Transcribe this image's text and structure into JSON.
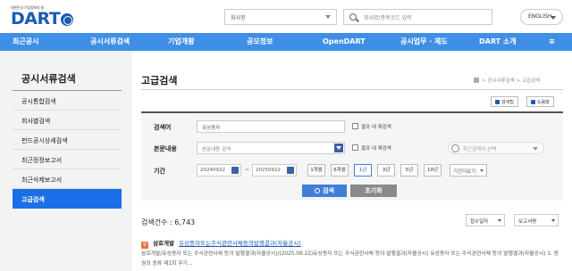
{
  "header": {
    "logo_small": "대한민국 기업정보의 창",
    "logo_big": "DART",
    "company_select": "회사명",
    "search_placeholder": "회사명/종목코드 입력",
    "language": "ENGLISH"
  },
  "nav": [
    {
      "label": "최근공시"
    },
    {
      "label": "공시서류검색"
    },
    {
      "label": "기업개황"
    },
    {
      "label": "공모정보"
    },
    {
      "label": "OpenDART"
    },
    {
      "label": "공시업무 · 제도"
    },
    {
      "label": "DART 소개"
    }
  ],
  "sidebar": {
    "title": "공시서류검색",
    "items": [
      {
        "label": "공시통합검색",
        "active": false
      },
      {
        "label": "회사별검색",
        "active": false
      },
      {
        "label": "펀드공시상세검색",
        "active": false
      },
      {
        "label": "최근정정보고서",
        "active": false
      },
      {
        "label": "최근삭제보고서",
        "active": false
      },
      {
        "label": "고급검색",
        "active": true
      }
    ]
  },
  "main": {
    "title": "고급검색",
    "breadcrumb": "> 공시서류검색 > 고급검색",
    "tips_button": "검색팁",
    "help_button": "도움말"
  },
  "form": {
    "keyword_label": "검색어",
    "keyword_value": "유상증자",
    "keyword_check": "결과 내 재검색",
    "body_label": "본문내용",
    "body_placeholder": "본문내용 검색",
    "body_check": "결과 내 재검색",
    "recent_placeholder": "최근검색어 선택",
    "period_label": "기간",
    "date_from": "20240922",
    "date_sep": "~",
    "date_to": "20250922",
    "periods": [
      {
        "label": "1개월",
        "selected": false
      },
      {
        "label": "6개월",
        "selected": false
      },
      {
        "label": "1년",
        "selected": true
      },
      {
        "label": "3년",
        "selected": false
      },
      {
        "label": "5년",
        "selected": false
      },
      {
        "label": "10년",
        "selected": false
      }
    ],
    "period_more": "기간더보기",
    "search_button": "검색",
    "reset_button": "초기화"
  },
  "results": {
    "count_label": "검색건수 :",
    "count_value": "6,743",
    "sort_order": "접수일자",
    "sort_view": "보고서명",
    "first": {
      "badge": "유",
      "company": "삼호개발",
      "report": "유상증자또는주식관련사채등의발행결과(자율공시)",
      "snippet": "삼호개발/유상증자 또는 주식관련사채 등의 발행결과(자율공시)/(2025.09.22)유상증자 또는 주식관련사채 등의 발행결과(자율공시) 유상증자 또는 주식관련사채 등의 발행결과(자율공시) 1. 증권의 종류 제1회 무기..."
    }
  },
  "colors": {
    "brand": "#1a5bb4",
    "nav_bg": "#3f8fe8",
    "active_side": "#1a6fe8",
    "search_btn": "#3f7fd8",
    "reset_btn": "#8a8a8a"
  }
}
